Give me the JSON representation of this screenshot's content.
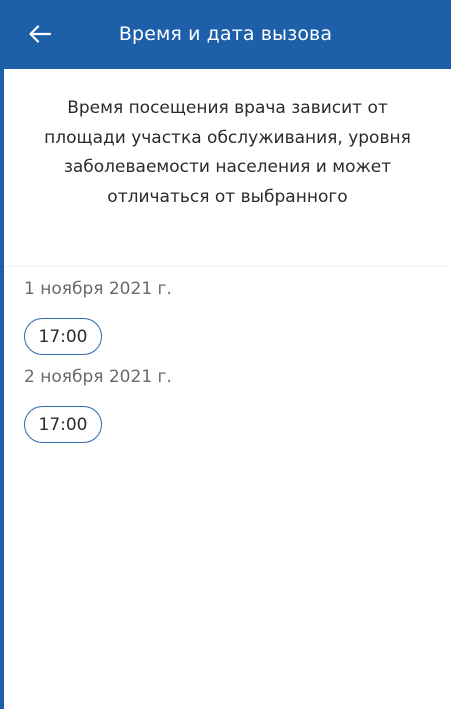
{
  "app_bar": {
    "title": "Время и дата вызова",
    "back_icon": "arrow-left-icon",
    "background": "#1d5fa8"
  },
  "info": {
    "lines": [
      "Время посещения врача зависит от",
      "площади участка обслуживания, уровня",
      "заболеваемости населения и может",
      "отличаться от выбранного"
    ]
  },
  "days": [
    {
      "date": "1 ноября 2021 г.",
      "times": [
        "17:00"
      ]
    },
    {
      "date": "2 ноября 2021 г.",
      "times": [
        "17:00"
      ]
    }
  ],
  "colors": {
    "accent": "#1d5fa8",
    "chip_border": "#2e6aae",
    "date_text": "#6a6a6a",
    "body_text": "#2b2b2b"
  }
}
